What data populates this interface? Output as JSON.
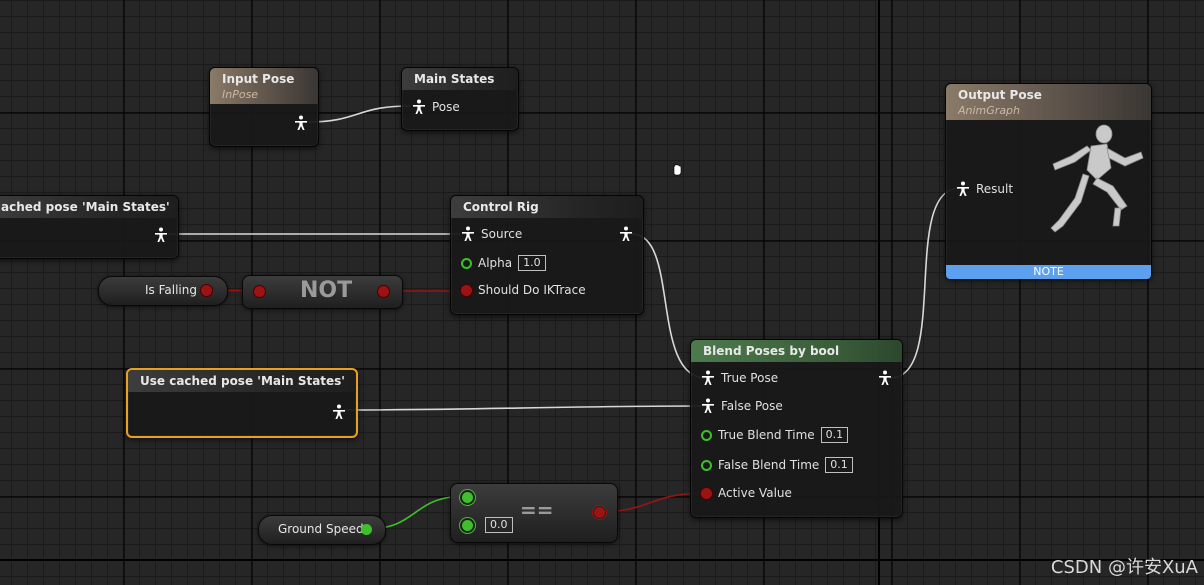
{
  "graph": {
    "input_pose": {
      "title": "Input Pose",
      "subtitle": "InPose"
    },
    "main_states": {
      "title": "Main States",
      "pin_pose": "Pose"
    },
    "output_pose": {
      "title": "Output Pose",
      "subtitle": "AnimGraph",
      "pin_result": "Result",
      "note": "NOTE"
    },
    "cached_pose_1": {
      "title": "ached pose 'Main States'"
    },
    "control_rig": {
      "title": "Control Rig",
      "pin_source": "Source",
      "pin_alpha": "Alpha",
      "alpha_value": "1.0",
      "pin_ik": "Should Do IKTrace"
    },
    "is_falling": {
      "label": "Is Falling"
    },
    "not_node": {
      "label": "NOT"
    },
    "cached_pose_2": {
      "title": "Use cached pose 'Main States'"
    },
    "blend_poses": {
      "title": "Blend Poses by bool",
      "pin_true_pose": "True Pose",
      "pin_false_pose": "False Pose",
      "pin_true_blend": "True Blend Time",
      "true_blend_value": "0.1",
      "pin_false_blend": "False Blend Time",
      "false_blend_value": "0.1",
      "pin_active": "Active Value"
    },
    "ground_speed": {
      "label": "Ground Speed"
    },
    "equals_node": {
      "label": "==",
      "value": "0.0"
    }
  },
  "colors": {
    "background": "#262626",
    "pose_wire": "#d8d8d8",
    "bool_wire": "#9a1414",
    "float_wire": "#3fbf2b",
    "selected_border": "#e8a020",
    "note_bar": "#5da0f0"
  },
  "watermark": "CSDN @许安XuA"
}
